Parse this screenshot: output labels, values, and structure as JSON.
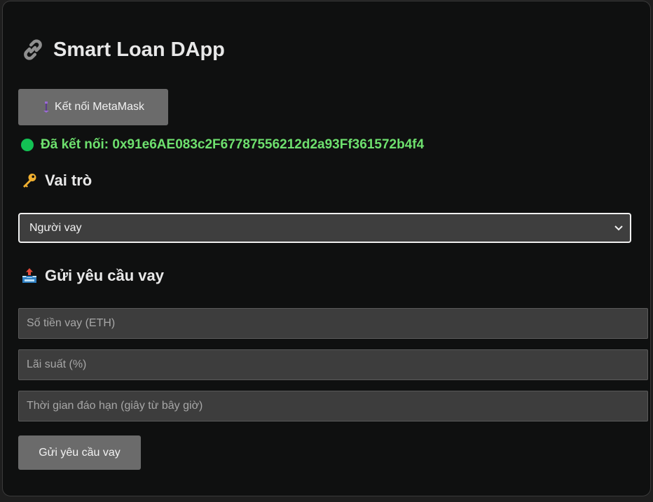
{
  "app": {
    "title": "Smart Loan DApp",
    "title_icon": "link-icon"
  },
  "connect": {
    "label": "Kết nối MetaMask",
    "icon": "metamask-fox-icon"
  },
  "status": {
    "text": "Đã kết nối: 0x91e6AE083c2F67787556212d2a93Ff361572b4f4",
    "indicator_color": "#13c254",
    "text_color": "#6ee06e"
  },
  "role": {
    "heading": "Vai trò",
    "icon": "key-icon",
    "selected": "Người vay"
  },
  "request": {
    "heading": "Gửi yêu cầu vay",
    "icon": "outbox-tray-icon",
    "amount_placeholder": "Số tiền vay (ETH)",
    "rate_placeholder": "Lãi suất (%)",
    "term_placeholder": "Thời gian đáo hạn (giây từ bây giờ)",
    "submit_label": "Gửi yêu cầu vay"
  }
}
